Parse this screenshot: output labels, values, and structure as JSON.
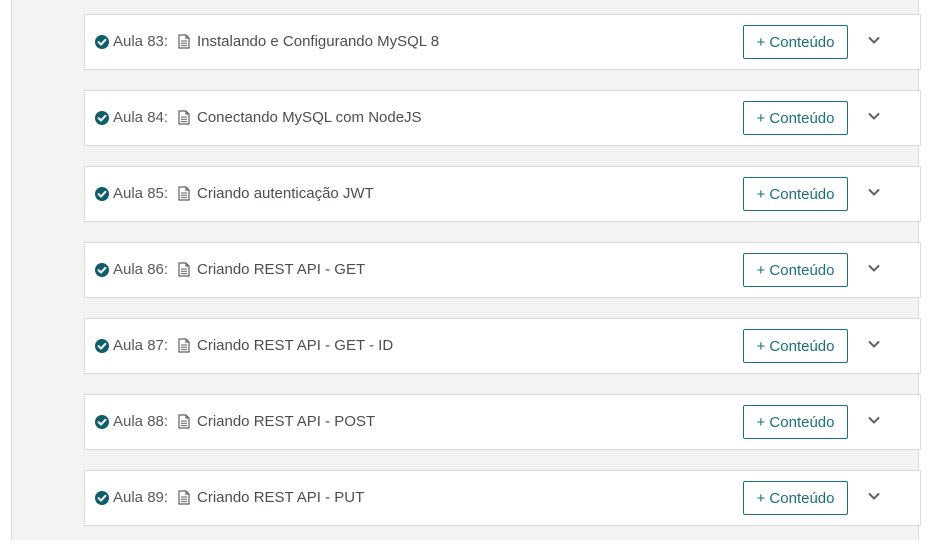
{
  "lessons": [
    {
      "number": "Aula 83:",
      "title": "Instalando e Configurando MySQL 8",
      "button_label": "+ Conteúdo"
    },
    {
      "number": "Aula 84:",
      "title": "Conectando MySQL com NodeJS",
      "button_label": "+ Conteúdo"
    },
    {
      "number": "Aula 85:",
      "title": "Criando autenticação JWT",
      "button_label": "+ Conteúdo"
    },
    {
      "number": "Aula 86:",
      "title": "Criando REST API - GET",
      "button_label": "+ Conteúdo"
    },
    {
      "number": "Aula 87:",
      "title": "Criando REST API - GET - ID",
      "button_label": "+ Conteúdo"
    },
    {
      "number": "Aula 88:",
      "title": "Criando REST API - POST",
      "button_label": "+ Conteúdo"
    },
    {
      "number": "Aula 89:",
      "title": "Criando REST API - PUT",
      "button_label": "+ Conteúdo"
    }
  ],
  "colors": {
    "accent": "#1b6f7c",
    "check": "#0f5f6b",
    "text": "#4a4e53",
    "panel_background": "#f3f3f4",
    "row_border": "#d8dadc"
  },
  "icons": {
    "status": "check-circle-icon",
    "lesson_type": "document-icon",
    "expand": "chevron-down-icon"
  }
}
